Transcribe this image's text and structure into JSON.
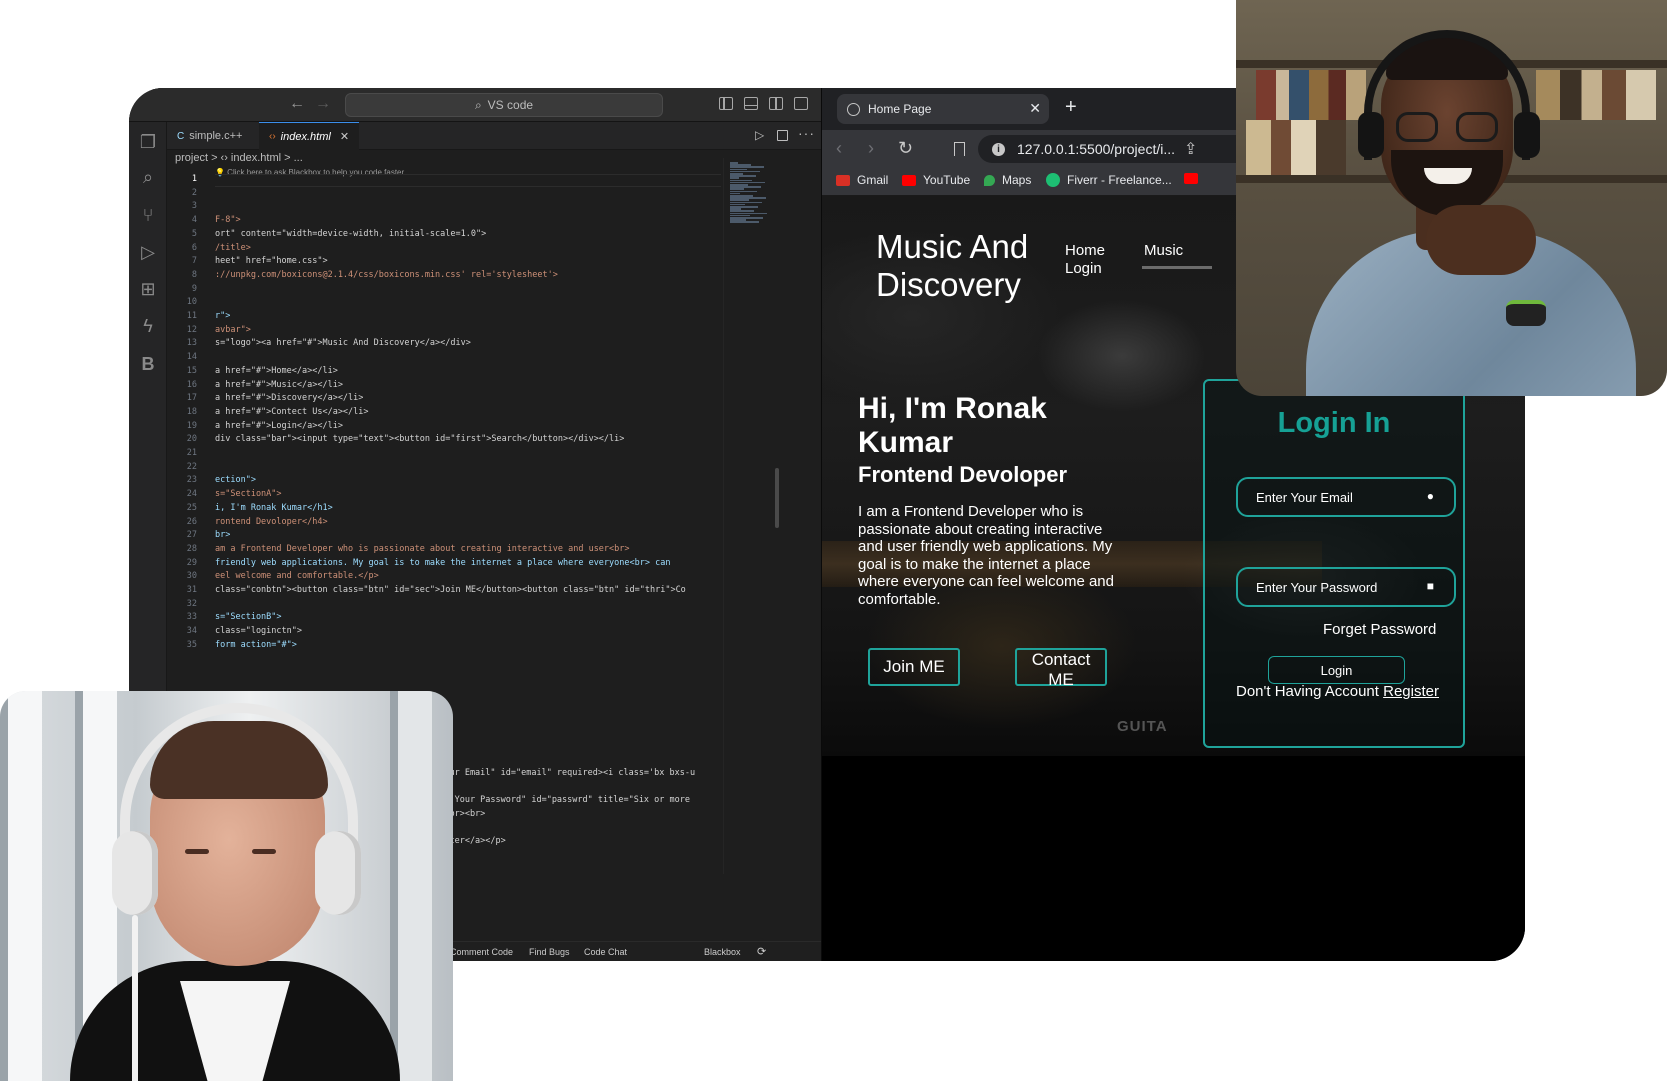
{
  "vscode": {
    "search_label": "VS code",
    "tabs": [
      {
        "label": "simple.c++",
        "icon": "c-file-icon"
      },
      {
        "label": "index.html",
        "icon": "html-file-icon"
      }
    ],
    "breadcrumb": "project > ‹› index.html > ...",
    "blackbox_hint": "💡 Click here to ask Blackbox to help you code faster",
    "line_numbers": [
      "1",
      "2",
      "3",
      "4",
      "5",
      "6",
      "7",
      "8",
      "9",
      "10",
      "11",
      "12",
      "13",
      "14",
      "15",
      "16",
      "17",
      "18",
      "19",
      "20",
      "21",
      "22",
      "23",
      "24",
      "25",
      "26",
      "27",
      "28",
      "29",
      "30",
      "31",
      "32",
      "33",
      "34",
      "35"
    ],
    "code_lines": [
      "",
      "",
      "",
      "F-8\">",
      "ort\" content=\"width=device-width, initial-scale=1.0\">",
      "/title>",
      "heet\" href=\"home.css\">",
      "://unpkg.com/boxicons@2.1.4/css/boxicons.min.css' rel='stylesheet'>",
      "",
      "",
      "r\">",
      "avbar\">",
      "s=\"logo\"><a href=\"#\">Music And Discovery</a></div>",
      "",
      "a href=\"#\">Home</a></li>",
      "a href=\"#\">Music</a></li>",
      "a href=\"#\">Discovery</a></li>",
      "a href=\"#\">Contect Us</a></li>",
      "a href=\"#\">Login</a></li>",
      "div class=\"bar\"><input type=\"text\"><button id=\"first\">Search</button></div></li>",
      "",
      "",
      "ection\">",
      "s=\"SectionA\">",
      "i, I'm Ronak Kumar</h1>",
      "rontend Devoloper</h4>",
      "br>",
      "am a Frontend Developer who is passionate about creating interactive and user<br>",
      "friendly web applications. My goal is to make the internet a place where everyone<br> can",
      "eel welcome and comfortable.</p>",
      "class=\"conbtn\"><button class=\"btn\" id=\"sec\">Join ME</button><button class=\"btn\" id=\"thri\">Co",
      "",
      "s=\"SectionB\">",
      "class=\"loginctn\">",
      "form action=\"#\">"
    ],
    "code_lines_lower": [
      "r Your Email\" id=\"email\" required><i class='bx bxs-u",
      "nter Your Password\" id=\"passwrd\" title=\"Six or more",
      "/a><br><br>",
      "egister</a></p>"
    ],
    "status": {
      "de": "de",
      "comment": "Comment Code",
      "bugs": "Find Bugs",
      "chat": "Code Chat",
      "blackbox": "Blackbox"
    }
  },
  "browser": {
    "tab_title": "Home Page",
    "url": "127.0.0.1:5500/project/i...",
    "bookmarks": [
      {
        "label": "Gmail",
        "color": "#d93025"
      },
      {
        "label": "YouTube",
        "color": "#ff0000"
      },
      {
        "label": "Maps",
        "color": "#34a853"
      },
      {
        "label": "Fiverr - Freelance...",
        "color": "#1dbf73"
      }
    ],
    "site": {
      "logo": "Music And Discovery",
      "nav": {
        "home": "Home",
        "music": "Music",
        "login": "Login"
      },
      "hero_name": "Hi, I'm Ronak Kumar",
      "hero_role": "Frontend Devoloper",
      "hero_bio": "I am a Frontend Developer who is passionate about creating interactive and user friendly web applications. My goal is to make the internet a place where everyone can feel welcome and comfortable.",
      "buttons": {
        "join": "Join ME",
        "contact": "Contact ME"
      },
      "background_text": "GUITA",
      "login": {
        "title": "Login In",
        "email_placeholder": "Enter Your Email",
        "password_placeholder": "Enter Your Password",
        "forgot": "Forget Password",
        "button": "Login",
        "no_account": "Don't Having Account",
        "register": "Register"
      }
    }
  },
  "colors": {
    "accent_teal": "#1fa39a",
    "login_title": "#16a195",
    "vscode_bg": "#1e1e1e",
    "browser_chrome": "#35363a"
  }
}
